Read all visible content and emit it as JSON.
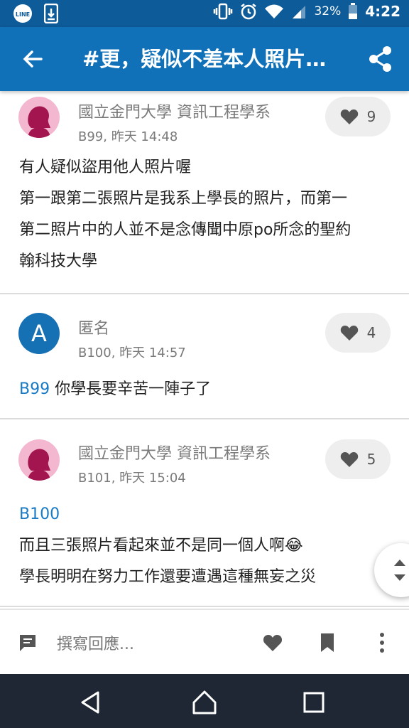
{
  "status_bar": {
    "time": "4:22",
    "battery": "32%",
    "icons": [
      "line-icon",
      "download-icon",
      "vibrate-icon",
      "alarm-icon",
      "wifi-icon",
      "signal-icon",
      "battery-icon"
    ]
  },
  "app_bar": {
    "title": "#更，疑似不差本人照片…",
    "back_icon": "back-arrow-icon",
    "share_icon": "share-icon"
  },
  "comments": [
    {
      "author": "國立金門大學 資訊工程學系",
      "floor": "B99, 昨天 14:48",
      "likes": "9",
      "avatar": "female-silhouette",
      "lines": [
        "有人疑似盜用他人照片喔",
        "第一跟第二張照片是我系上學長的照片，而第一",
        "第二照片中的人並不是念傳聞中原po所念的聖約",
        "翰科技大學"
      ]
    },
    {
      "author": "匿名",
      "floor": "B100, 昨天 14:57",
      "likes": "4",
      "avatar_letter": "A",
      "reply_ref": "B99",
      "text": " 你學長要辛苦一陣子了"
    },
    {
      "author": "國立金門大學 資訊工程學系",
      "floor": "B101, 昨天 15:04",
      "likes": "5",
      "avatar": "female-silhouette",
      "reply_ref": "B100",
      "lines": [
        "而且三張照片看起來並不是同一個人啊😂",
        "學長明明在努力工作還要遭遇這種無妄之災"
      ]
    }
  ],
  "bottom_bar": {
    "placeholder": "撰寫回應..."
  },
  "colors": {
    "app_bar": "#1070b8",
    "status_bar": "#0d5b99",
    "link": "#1a7ac4",
    "nav_bar": "#1e2733"
  }
}
